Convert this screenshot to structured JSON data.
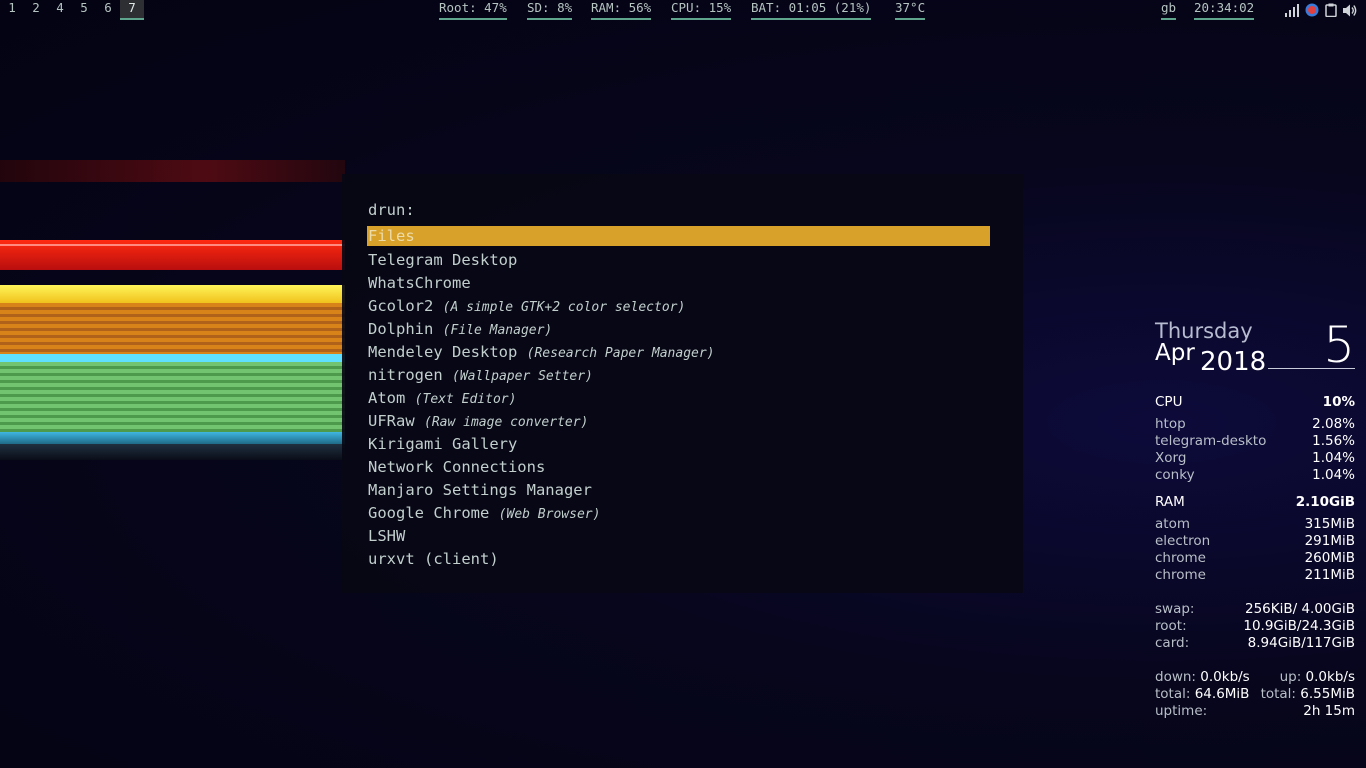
{
  "topbar": {
    "workspaces": [
      {
        "label": "1",
        "active": false
      },
      {
        "label": "2",
        "active": false
      },
      {
        "label": "4",
        "active": false
      },
      {
        "label": "5",
        "active": false
      },
      {
        "label": "6",
        "active": false
      },
      {
        "label": "7",
        "active": true
      }
    ],
    "stats": {
      "root": "Root: 47%",
      "sd": "SD: 8%",
      "ram": "RAM: 56%",
      "cpu": "CPU: 15%",
      "bat": "BAT: 01:05 (21%)",
      "temp": "37°C"
    },
    "layout": "gb",
    "clock": "20:34:02",
    "tray_icons": [
      "signal-icon",
      "record-icon",
      "clipboard-icon",
      "volume-icon"
    ],
    "colors": {
      "accent_underline": "#5fa58d"
    }
  },
  "rofi": {
    "prompt": "drun:",
    "selected_color": "#d7a12a",
    "entries": [
      {
        "name": "Files",
        "desc": ""
      },
      {
        "name": "Telegram Desktop",
        "desc": ""
      },
      {
        "name": "WhatsChrome",
        "desc": ""
      },
      {
        "name": "Gcolor2",
        "desc": "(A simple GTK+2 color selector)"
      },
      {
        "name": "Dolphin",
        "desc": "(File Manager)"
      },
      {
        "name": "Mendeley Desktop",
        "desc": "(Research Paper Manager)"
      },
      {
        "name": "nitrogen",
        "desc": "(Wallpaper Setter)"
      },
      {
        "name": "Atom",
        "desc": "(Text Editor)"
      },
      {
        "name": "UFRaw",
        "desc": "(Raw image converter)"
      },
      {
        "name": "Kirigami Gallery",
        "desc": ""
      },
      {
        "name": "Network Connections",
        "desc": ""
      },
      {
        "name": "Manjaro Settings Manager",
        "desc": ""
      },
      {
        "name": "Google Chrome",
        "desc": "(Web Browser)"
      },
      {
        "name": "LSHW",
        "desc": ""
      },
      {
        "name": "urxvt (client)",
        "desc": ""
      }
    ]
  },
  "conky": {
    "date": {
      "day": "Thursday",
      "month": "Apr",
      "year": "2018",
      "daynum": "5"
    },
    "cpu": {
      "label": "CPU",
      "total": "10%",
      "procs": [
        {
          "name": "htop",
          "val": "2.08%"
        },
        {
          "name": "telegram-deskto",
          "val": "1.56%"
        },
        {
          "name": "Xorg",
          "val": "1.04%"
        },
        {
          "name": "conky",
          "val": "1.04%"
        }
      ]
    },
    "ram": {
      "label": "RAM",
      "total": "2.10GiB",
      "procs": [
        {
          "name": "atom",
          "val": "315MiB"
        },
        {
          "name": "electron",
          "val": "291MiB"
        },
        {
          "name": "chrome",
          "val": "260MiB"
        },
        {
          "name": "chrome",
          "val": "211MiB"
        }
      ]
    },
    "storage": [
      {
        "name": "swap:",
        "val": "256KiB/ 4.00GiB"
      },
      {
        "name": "root:",
        "val": "10.9GiB/24.3GiB"
      },
      {
        "name": "card:",
        "val": "8.94GiB/117GiB"
      }
    ],
    "net": {
      "down_label": "down:",
      "down": "0.0kb/s",
      "up_label": "up:",
      "up": "0.0kb/s",
      "total_down_label": "total:",
      "total_down": "64.6MiB",
      "total_up_label": "total:",
      "total_up": "6.55MiB",
      "uptime_label": "uptime:",
      "uptime": "2h 15m"
    }
  }
}
